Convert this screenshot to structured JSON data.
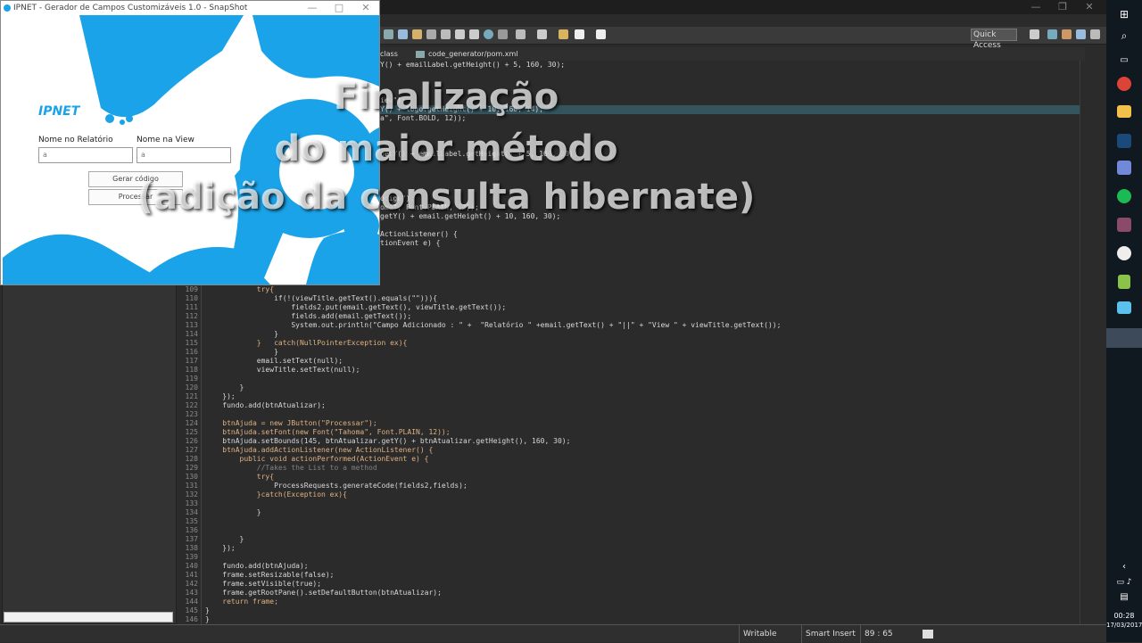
{
  "snapshot": {
    "title": "IPNET - Gerador de Campos Customizáveis 1.0 - SnapShot",
    "logo": "IPNET",
    "label_relatorio": "Nome no Relatório",
    "label_view": "Nome na View",
    "input_relatorio": "a",
    "input_view": "a",
    "button_gerar": "Gerar código",
    "button_processar": "Processar",
    "ctl_min": "—",
    "ctl_max": "□",
    "ctl_close": "✕"
  },
  "overlay": {
    "line1": "Finalização",
    "line2": "do maior método",
    "line3": "(adição da consulta hibernate)"
  },
  "ide": {
    "quick_access": "Quick Access",
    "tab1": "class",
    "tab2": "code_generator/pom.xml",
    "ctl_min": "—",
    "ctl_max": "❐",
    "ctl_close": "✕"
  },
  "status": {
    "writable": "Writable",
    "insert": "Smart Insert",
    "position": "89 : 65"
  },
  "taskbar": {
    "time": "00:28",
    "date": "17/03/2017"
  },
  "code_top": [
    {
      "t": "Y() + emailLabel.getHeight() + 5, 160, 30);"
    },
    {
      "t": "iew\");"
    },
    {
      "t": "Y() + logo.getHeight() + 10, 160, 14);"
    },
    {
      "t": "a\", Font.BOLD, 12));"
    },
    {
      "t": "getY() + emailLabel.getHeight() + 5, 160, 30);"
    },
    {
      "t": "ódigo\");"
    },
    {
      "t": "oma\", Font.PLAIN, 12));"
    },
    {
      "t": "getY() + email.getHeight() + 10, 160, 30);"
    },
    {
      "t": "ActionListener() {"
    },
    {
      "t": "tionEvent e) {"
    }
  ],
  "code": [
    {
      "n": "109",
      "t": "            try{"
    },
    {
      "n": "110",
      "t": "                if(!(viewTitle.getText().equals(\"\"))){"
    },
    {
      "n": "111",
      "t": "                    fields2.put(email.getText(), viewTitle.getText());"
    },
    {
      "n": "112",
      "t": "                    fields.add(email.getText());"
    },
    {
      "n": "113",
      "t": "                    System.out.println(\"Campo Adicionado : \" +  \"Relatório \" +email.getText() + \"||\" + \"View \" + viewTitle.getText());"
    },
    {
      "n": "114",
      "t": "                }"
    },
    {
      "n": "115",
      "t": "            }   catch(NullPointerException ex){"
    },
    {
      "n": "116",
      "t": "                }"
    },
    {
      "n": "117",
      "t": "            email.setText(null);"
    },
    {
      "n": "118",
      "t": "            viewTitle.setText(null);"
    },
    {
      "n": "119",
      "t": ""
    },
    {
      "n": "120",
      "t": "        }"
    },
    {
      "n": "121",
      "t": "    });"
    },
    {
      "n": "122",
      "t": "    fundo.add(btnAtualizar);"
    },
    {
      "n": "123",
      "t": ""
    },
    {
      "n": "124",
      "t": "    btnAjuda = new JButton(\"Processar\");"
    },
    {
      "n": "125",
      "t": "    btnAjuda.setFont(new Font(\"Tahoma\", Font.PLAIN, 12));"
    },
    {
      "n": "126",
      "t": "    btnAjuda.setBounds(145, btnAtualizar.getY() + btnAtualizar.getHeight(), 160, 30);"
    },
    {
      "n": "127",
      "t": "    btnAjuda.addActionListener(new ActionListener() {"
    },
    {
      "n": "128",
      "t": "        public void actionPerformed(ActionEvent e) {"
    },
    {
      "n": "129",
      "t": "            //Takes the List to a method"
    },
    {
      "n": "130",
      "t": "            try{"
    },
    {
      "n": "131",
      "t": "                ProcessRequests.generateCode(fields2,fields);"
    },
    {
      "n": "132",
      "t": "            }catch(Exception ex){"
    },
    {
      "n": "133",
      "t": ""
    },
    {
      "n": "134",
      "t": "            }"
    },
    {
      "n": "135",
      "t": ""
    },
    {
      "n": "136",
      "t": ""
    },
    {
      "n": "137",
      "t": "        }"
    },
    {
      "n": "138",
      "t": "    });"
    },
    {
      "n": "139",
      "t": ""
    },
    {
      "n": "140",
      "t": "    fundo.add(btnAjuda);"
    },
    {
      "n": "141",
      "t": "    frame.setResizable(false);"
    },
    {
      "n": "142",
      "t": "    frame.setVisible(true);"
    },
    {
      "n": "143",
      "t": "    frame.getRootPane().setDefaultButton(btnAtualizar);"
    },
    {
      "n": "144",
      "t": "    return frame;"
    },
    {
      "n": "145",
      "t": "}"
    },
    {
      "n": "146",
      "t": "}"
    }
  ],
  "colors": {
    "accent": "#1aa3e8",
    "editor_bg": "#2b2b2b",
    "keyword": "#cc7832"
  }
}
